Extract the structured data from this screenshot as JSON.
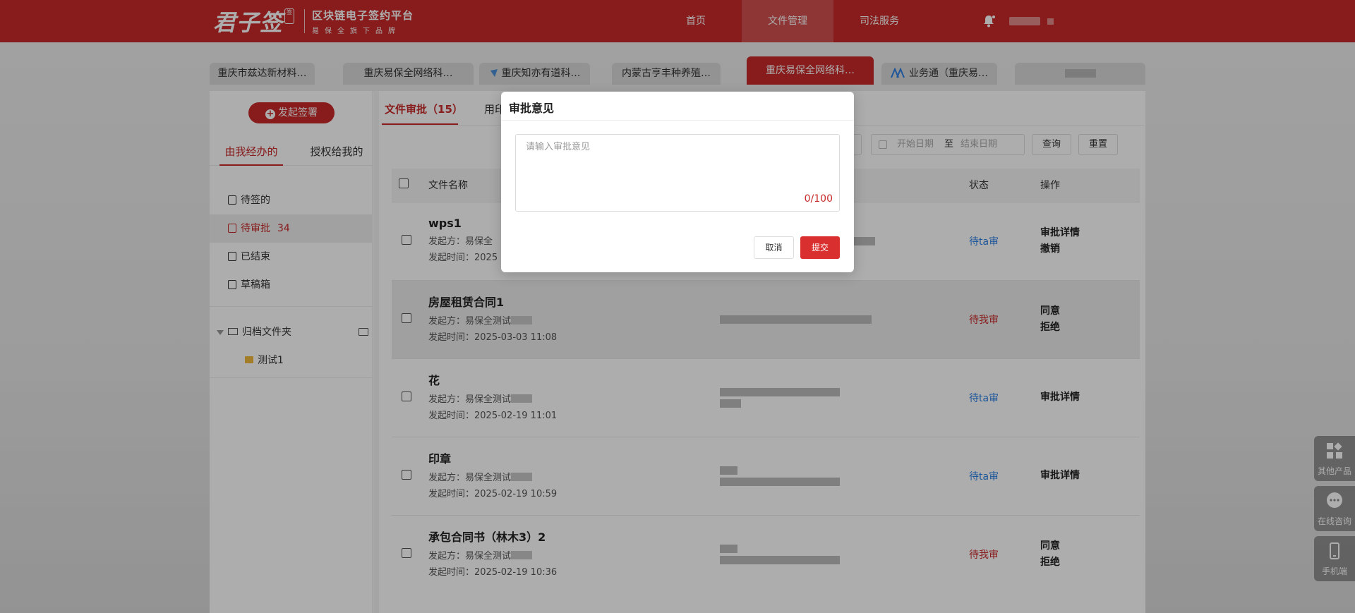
{
  "header": {
    "logo_mark": "君子签",
    "logo_line1": "区块链电子签约平台",
    "logo_line2": "易保全旗下品牌",
    "nav": [
      "首页",
      "文件管理",
      "司法服务"
    ],
    "active_nav": "文件管理",
    "brand_color": "#c92a2a"
  },
  "tabs": [
    {
      "label": "重庆市兹达新材料…"
    },
    {
      "label": "重庆易保全网络科…"
    },
    {
      "label": "重庆知亦有道科…"
    },
    {
      "label": "内蒙古亨丰种养殖…"
    },
    {
      "label": "重庆易保全网络科…",
      "active": true
    },
    {
      "label": "业务通（重庆易…"
    }
  ],
  "sidebar": {
    "start_button": "发起签署",
    "tabs": [
      "由我经办的",
      "授权给我的"
    ],
    "menu": [
      {
        "label": "待签的",
        "icon": "document-sign-icon"
      },
      {
        "label": "待审批",
        "count": "34",
        "icon": "document-approval-icon",
        "active": true
      },
      {
        "label": "已结束",
        "icon": "document-done-icon"
      },
      {
        "label": "草稿箱",
        "icon": "draft-icon"
      }
    ],
    "archive_label": "归档文件夹",
    "folder_label": "测试1"
  },
  "content": {
    "tabs": [
      "文件审批（15）",
      "用印"
    ],
    "date_start_placeholder": "开始日期",
    "date_to": "至",
    "date_end_placeholder": "结束日期",
    "query_button": "查询",
    "reset_button": "重置",
    "table_headers": {
      "name": "文件名称",
      "status": "状态",
      "action": "操作"
    },
    "rows": [
      {
        "name": "wps1",
        "initiator": "发起方：易保全",
        "time": "发起时间：2025",
        "status": "待ta审",
        "status_type": "ta",
        "ops": [
          "审批详情",
          "撤销"
        ]
      },
      {
        "name": "房屋租赁合同1",
        "initiator": "发起方：易保全测试",
        "time": "发起时间：2025-03-03 11:08",
        "status": "待我审",
        "status_type": "me",
        "ops": [
          "同意",
          "拒绝"
        ]
      },
      {
        "name": "花",
        "initiator": "发起方：易保全测试",
        "time": "发起时间：2025-02-19 11:01",
        "status": "待ta审",
        "status_type": "ta",
        "ops": [
          "审批详情"
        ]
      },
      {
        "name": "印章",
        "initiator": "发起方：易保全测试",
        "time": "发起时间：2025-02-19 10:59",
        "status": "待ta审",
        "status_type": "ta",
        "ops": [
          "审批详情"
        ]
      },
      {
        "name": "承包合同书（林木3）2",
        "initiator": "发起方：易保全测试",
        "time": "发起时间：2025-02-19 10:36",
        "status": "待我审",
        "status_type": "me",
        "ops": [
          "同意",
          "拒绝"
        ]
      }
    ]
  },
  "float_bar": [
    {
      "label": "其他产品",
      "icon": "apps-icon"
    },
    {
      "label": "在线咨询",
      "icon": "chat-icon"
    },
    {
      "label": "手机端",
      "icon": "mobile-icon"
    }
  ],
  "modal": {
    "title": "审批意见",
    "placeholder": "请输入审批意见",
    "counter": "0/100",
    "cancel": "取消",
    "submit": "提交"
  }
}
